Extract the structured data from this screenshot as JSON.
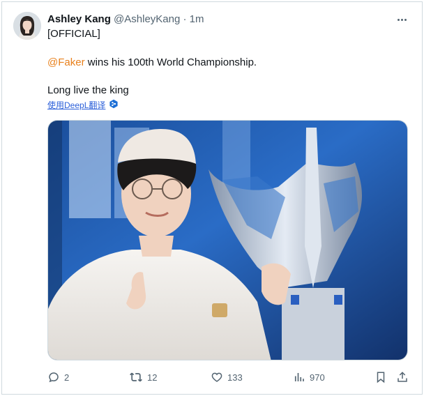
{
  "tweet": {
    "author": {
      "name": "Ashley Kang",
      "handle": "@AshleyKang",
      "separator": "·",
      "time": "1m"
    },
    "lines": {
      "line1": "[OFFICIAL]",
      "mention": "@Faker",
      "line2_rest": " wins his 100th World Championship.",
      "line3": "Long live the king"
    },
    "translate_label": "使用DeepL翻译",
    "actions": {
      "replies": "2",
      "retweets": "12",
      "likes": "133",
      "views": "970"
    }
  },
  "icons": {
    "more": "more-horizontal-icon",
    "translate": "deepl-icon",
    "reply": "reply-icon",
    "retweet": "retweet-icon",
    "like": "heart-icon",
    "views": "analytics-icon",
    "bookmark": "bookmark-icon",
    "share": "share-icon"
  },
  "colors": {
    "text": "#0f1419",
    "secondary": "#536471",
    "mention": "#e8801c",
    "translate_link": "#2b5fd9",
    "border": "#cfd9de"
  }
}
